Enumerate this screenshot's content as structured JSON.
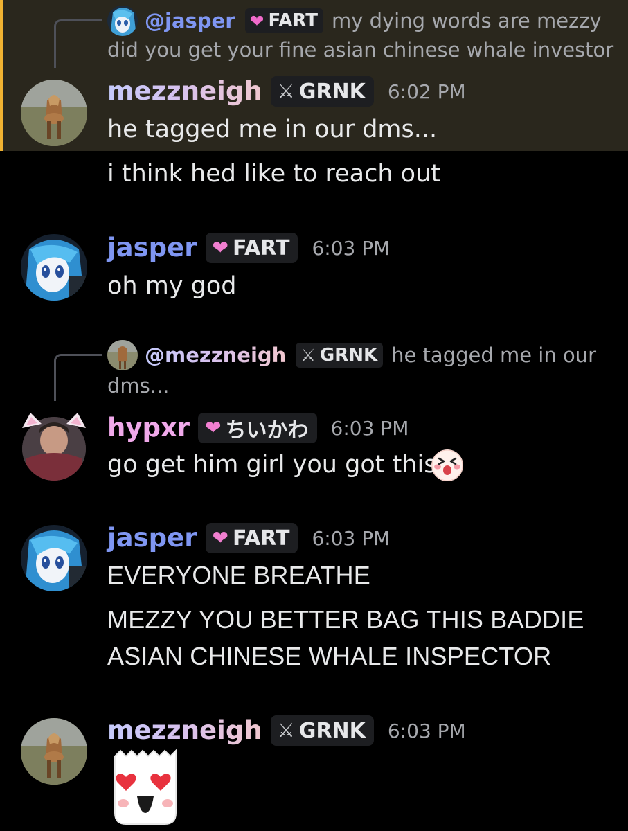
{
  "colors": {
    "mention_highlight": "#2a271d",
    "mention_bar": "#f0b232",
    "background": "#000000",
    "jasper_name": "#7f96f2",
    "hypxr_name": "#f0a9ea",
    "timestamp": "#a6a8ad"
  },
  "messages": [
    {
      "reply": {
        "user": "@jasper",
        "tag_icon": "heart-icon",
        "tag": "FART",
        "text_line1": "my dying words are mezzy",
        "text_line2": "did you get your fine asian chinese whale investor"
      },
      "author": "mezzneigh",
      "tag_icon": "sword-icon",
      "tag": "GRNK",
      "time": "6:02 PM",
      "lines": [
        "he tagged me in our dms...",
        "i think hed like to reach out"
      ]
    },
    {
      "author": "jasper",
      "tag_icon": "heart-icon",
      "tag": "FART",
      "time": "6:03 PM",
      "lines": [
        "oh my god"
      ]
    },
    {
      "reply": {
        "user": "@mezzneigh",
        "tag_icon": "sword-icon",
        "tag": "GRNK",
        "text_line1": "he tagged me in our",
        "text_line2": "dms..."
      },
      "author": "hypxr",
      "tag_icon": "heart-icon",
      "tag": "ちいかわ",
      "time": "6:03 PM",
      "lines": [
        "go get him girl you got this"
      ],
      "emoji": "laughing-face-emoji"
    },
    {
      "author": "jasper",
      "tag_icon": "heart-icon",
      "tag": "FART",
      "time": "6:03 PM",
      "lines": [
        "EVERYONE BREATHE",
        "MEZZY YOU BETTER BAG THIS BADDIE",
        "ASIAN CHINESE WHALE INSPECTOR"
      ]
    },
    {
      "author": "mezzneigh",
      "tag_icon": "sword-icon",
      "tag": "GRNK",
      "time": "6:03 PM",
      "sticker": "heart-eyes-ghost-sticker"
    }
  ]
}
